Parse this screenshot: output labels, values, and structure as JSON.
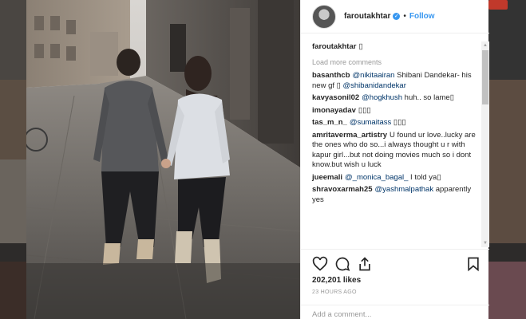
{
  "post": {
    "username": "faroutakhtar",
    "verified_mark": "✓",
    "separator": "•",
    "follow_label": "Follow",
    "caption_user": "faroutakhtar",
    "caption_text": "▯",
    "load_more_label": "Load more comments",
    "likes": "202,201 likes",
    "time_ago": "23 HOURS AGO",
    "add_comment_placeholder": "Add a comment..."
  },
  "comments": [
    {
      "user": "basanthcb",
      "mention": "@nikitaairan",
      "text": " Shibani Dandekar- his new gf ▯ ",
      "mention2": "@shibanidandekar",
      "text2": ""
    },
    {
      "user": "kavyasonil02",
      "mention": "@hogkhush",
      "text": " huh.. so lame▯",
      "mention2": "",
      "text2": ""
    },
    {
      "user": "imonayadav",
      "mention": "",
      "text": "▯▯▯",
      "mention2": "",
      "text2": ""
    },
    {
      "user": "tas_m_n_",
      "mention": "@sumaitass",
      "text": " ▯▯▯",
      "mention2": "",
      "text2": ""
    },
    {
      "user": "amritaverma_artistry",
      "mention": "",
      "text": "U found ur love..lucky are the ones who do so...i always thought u r with kapur girl...but not doing movies much so i dont know.but wish u luck",
      "mention2": "",
      "text2": ""
    },
    {
      "user": "jueemali",
      "mention": "@_monica_bagal_",
      "text": " I told ya▯",
      "mention2": "",
      "text2": ""
    },
    {
      "user": "shravoxarmah25",
      "mention": "@yashmalpathak",
      "text": " apparently yes",
      "mention2": "",
      "text2": ""
    }
  ],
  "icons": {
    "like": "heart-icon",
    "comment": "comment-icon",
    "share": "share-icon",
    "save": "bookmark-icon"
  },
  "colors": {
    "accent": "#3897f0",
    "text": "#262626",
    "muted": "#999999",
    "mention": "#003569"
  }
}
